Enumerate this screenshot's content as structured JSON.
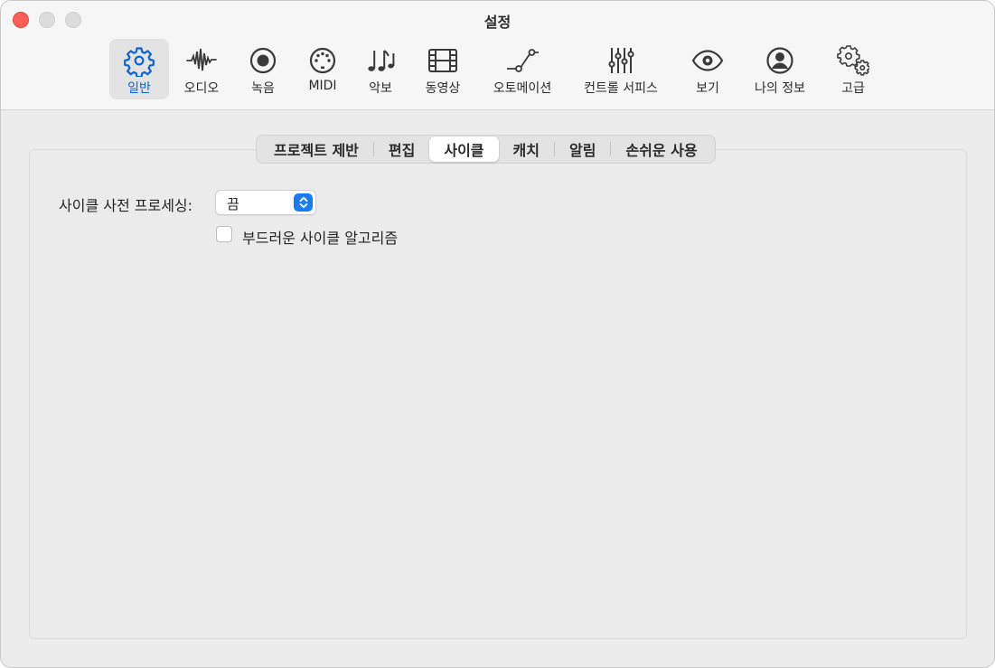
{
  "window": {
    "title": "설정"
  },
  "toolbar": {
    "items": [
      {
        "label": "일반",
        "icon": "gear-icon",
        "selected": true
      },
      {
        "label": "오디오",
        "icon": "waveform-icon"
      },
      {
        "label": "녹음",
        "icon": "record-icon"
      },
      {
        "label": "MIDI",
        "icon": "midi-port-icon"
      },
      {
        "label": "악보",
        "icon": "music-notes-icon"
      },
      {
        "label": "동영상",
        "icon": "film-icon"
      },
      {
        "label": "오토메이션",
        "icon": "automation-curve-icon"
      },
      {
        "label": "컨트롤 서피스",
        "icon": "sliders-icon"
      },
      {
        "label": "보기",
        "icon": "eye-icon"
      },
      {
        "label": "나의 정보",
        "icon": "person-circle-icon"
      },
      {
        "label": "고급",
        "icon": "gears-icon"
      }
    ]
  },
  "tabs": [
    {
      "label": "프로젝트 제반"
    },
    {
      "label": "편집"
    },
    {
      "label": "사이클",
      "active": true
    },
    {
      "label": "캐치"
    },
    {
      "label": "알림"
    },
    {
      "label": "손쉬운 사용"
    }
  ],
  "cycle": {
    "preprocess_label": "사이클 사전 프로세싱:",
    "preprocess_value": "끔",
    "smooth_label": "부드러운 사이클 알고리즘",
    "smooth_checked": false
  },
  "colors": {
    "accent": "#1a7cf5",
    "selected_label": "#0a64d6",
    "close_button": "#ff5f57"
  }
}
